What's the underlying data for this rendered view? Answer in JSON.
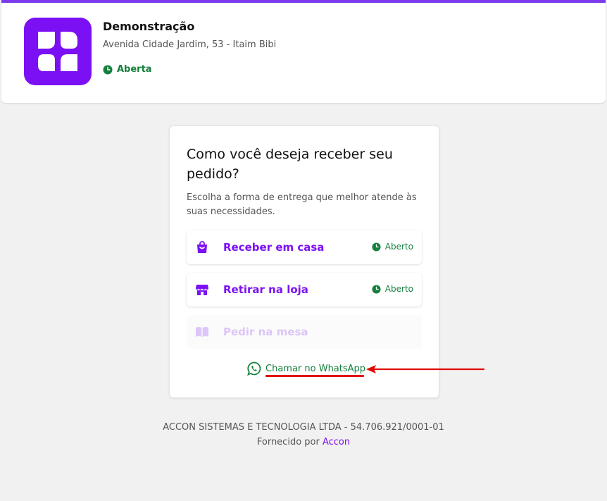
{
  "header": {
    "store_name": "Demonstração",
    "address": "Avenida Cidade Jardim, 53 - Itaim Bibi",
    "status": "Aberta",
    "logo_icon": "brand-logo-icon"
  },
  "delivery": {
    "title": "Como você deseja receber seu pedido?",
    "subtitle": "Escolha a forma de entrega que melhor atende às suas necessidades.",
    "options": [
      {
        "label": "Receber em casa",
        "icon": "shopping-bag-icon",
        "status": "Aberto",
        "enabled": true
      },
      {
        "label": "Retirar na loja",
        "icon": "store-icon",
        "status": "Aberto",
        "enabled": true
      },
      {
        "label": "Pedir na mesa",
        "icon": "book-icon",
        "status": "",
        "enabled": false
      }
    ],
    "whatsapp_label": "Chamar no WhatsApp"
  },
  "footer": {
    "company": "ACCON SISTEMAS E TECNOLOGIA LTDA - 54.706.921/0001-01",
    "powered_prefix": "Fornecido por",
    "powered_link": "Accon"
  },
  "colors": {
    "brand": "#7c10f4",
    "open_status": "#15803d",
    "annotation": "#e10600"
  }
}
